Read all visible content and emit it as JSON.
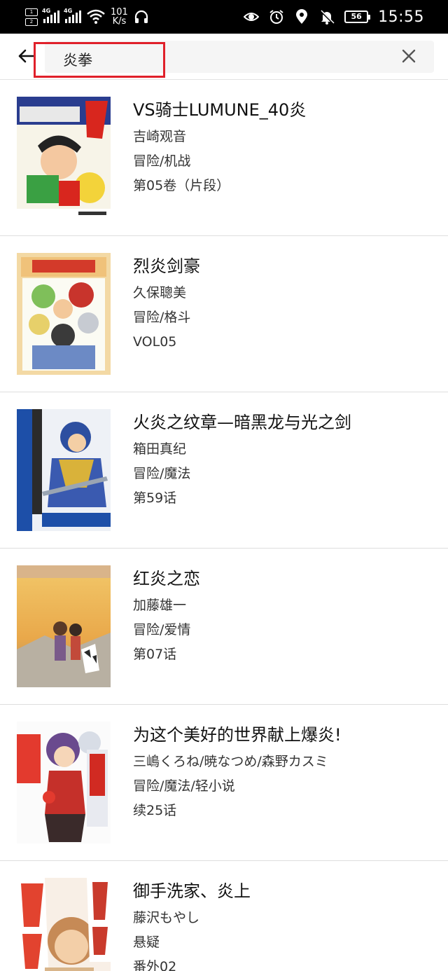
{
  "status_bar": {
    "network_type_1": "4G",
    "network_type_2": "4G",
    "net_speed_value": "101",
    "net_speed_unit": "K/s",
    "battery_level": "56",
    "time": "15:55"
  },
  "search": {
    "query": "炎拳",
    "accent_color": "#e0202a"
  },
  "results": [
    {
      "title": "VS骑士LUMUNE_40炎",
      "author": "吉崎观音",
      "genre": "冒险/机战",
      "chapter": "第05卷（片段）",
      "cover_icon": "manga-cover-vs-knight"
    },
    {
      "title": "烈炎剑豪",
      "author": "久保聰美",
      "genre": "冒险/格斗",
      "chapter": "VOL05",
      "cover_icon": "manga-cover-rekka"
    },
    {
      "title": "火炎之纹章—暗黑龙与光之剑",
      "author": "箱田真纪",
      "genre": "冒险/魔法",
      "chapter": "第59话",
      "cover_icon": "manga-cover-fire-emblem"
    },
    {
      "title": "红炎之恋",
      "author": "加藤雄一",
      "genre": "冒险/爱情",
      "chapter": "第07话",
      "cover_icon": "manga-cover-red-flame"
    },
    {
      "title": "为这个美好的世界献上爆炎!",
      "author": "三嶋くろね/暁なつめ/森野カスミ",
      "genre": "冒险/魔法/轻小说",
      "chapter": "续25话",
      "cover_icon": "manga-cover-konosuba"
    },
    {
      "title": "御手洗家、炎上",
      "author": "藤沢もやし",
      "genre": "悬疑",
      "chapter": "番外02",
      "cover_icon": "manga-cover-mitarai"
    }
  ]
}
